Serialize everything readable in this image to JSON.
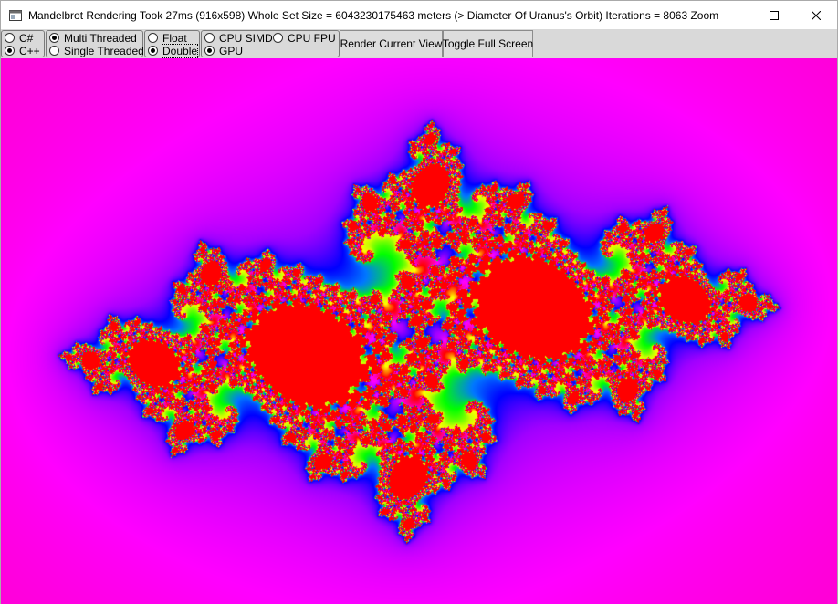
{
  "window": {
    "title": "Mandelbrot Rendering Took 27ms (916x598)  Whole Set Size = 6043230175463 meters (> Diameter Of Uranus's Orbit)  Iterations = 8063  Zoom...",
    "icon": "app-window-icon",
    "controls": {
      "minimize_icon": "minimize-icon",
      "maximize_icon": "maximize-icon",
      "close_icon": "close-icon"
    }
  },
  "toolbar": {
    "language": {
      "options": [
        {
          "label": "C#",
          "checked": false
        },
        {
          "label": "C++",
          "checked": true
        }
      ]
    },
    "threading": {
      "options": [
        {
          "label": "Multi Threaded",
          "checked": true
        },
        {
          "label": "Single Threaded",
          "checked": false
        }
      ]
    },
    "precision": {
      "options": [
        {
          "label": "Float",
          "checked": false
        },
        {
          "label": "Double",
          "checked": true
        }
      ]
    },
    "device": {
      "options": [
        {
          "label": "CPU SIMD",
          "checked": false
        },
        {
          "label": "CPU FPU",
          "checked": false
        },
        {
          "label": "GPU",
          "checked": true
        }
      ]
    },
    "render_button": "Render Current View",
    "fullscreen_button": "Toggle Full Screen"
  },
  "viewport": {
    "description_colors": {
      "background": "#ff00cc",
      "palette": [
        "#ff0080",
        "#ff00ff",
        "#0000ff",
        "#00ff00",
        "#ffff00",
        "#ff0000"
      ]
    }
  }
}
